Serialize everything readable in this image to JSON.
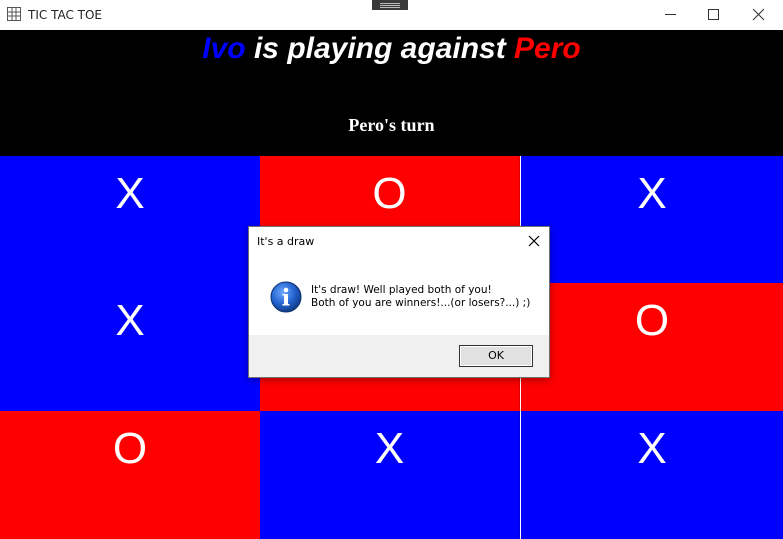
{
  "window": {
    "title": "TIC TAC TOE"
  },
  "header": {
    "player1": "Ivo",
    "middle": " is playing against ",
    "player2": "Pero",
    "turn": "Pero's turn"
  },
  "board": {
    "cells": [
      {
        "mark": "X",
        "color": "blue"
      },
      {
        "mark": "O",
        "color": "red"
      },
      {
        "mark": "X",
        "color": "blue"
      },
      {
        "mark": "X",
        "color": "blue"
      },
      {
        "mark": "",
        "color": "red"
      },
      {
        "mark": "O",
        "color": "red"
      },
      {
        "mark": "O",
        "color": "red"
      },
      {
        "mark": "X",
        "color": "blue"
      },
      {
        "mark": "X",
        "color": "blue"
      }
    ]
  },
  "dialog": {
    "title": "It's a draw",
    "line1": "It's draw! Well played both of you!",
    "line2": "Both of you are winners!...(or losers?...) ;)",
    "ok_label": "OK",
    "icon": "info-icon"
  },
  "colors": {
    "player1": "#0000ff",
    "player2": "#ff0000",
    "header_bg": "#000000"
  }
}
